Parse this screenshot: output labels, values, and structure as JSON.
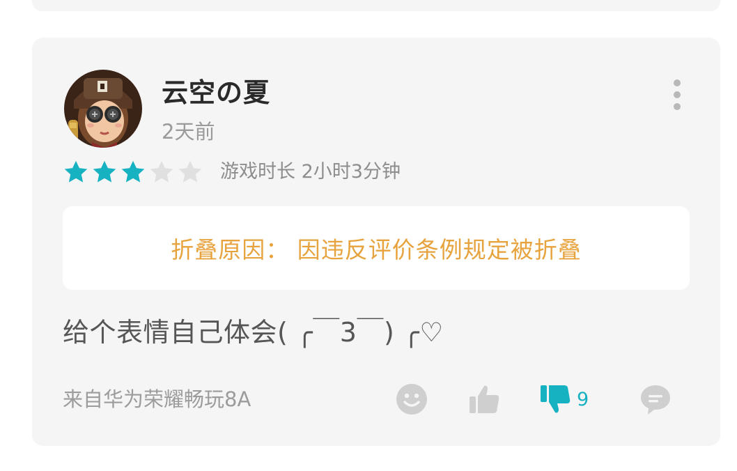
{
  "review": {
    "username": "云空の夏",
    "time": "2天前",
    "rating": 3,
    "rating_max": 5,
    "play_time": "游戏时长 2小时3分钟",
    "fold_notice": "折叠原因： 因违反评价条例规定被折叠",
    "content": "给个表情自己体会( ╭￣3￣) ╭♡",
    "device": "来自华为荣耀畅玩8A",
    "actions": {
      "dislike_count": "9"
    }
  },
  "colors": {
    "accent": "#17b2c2",
    "star_active": "#17b2c2",
    "star_inactive": "#e0e0e0",
    "fold_text": "#e7a33e",
    "icon_inactive": "#cfcfcf",
    "card_bg": "#f5f5f5"
  },
  "icons": {
    "more": "more-vertical-icon",
    "emoji": "smiley-icon",
    "like": "thumbs-up-icon",
    "dislike": "thumbs-down-icon",
    "reply": "comment-icon"
  }
}
